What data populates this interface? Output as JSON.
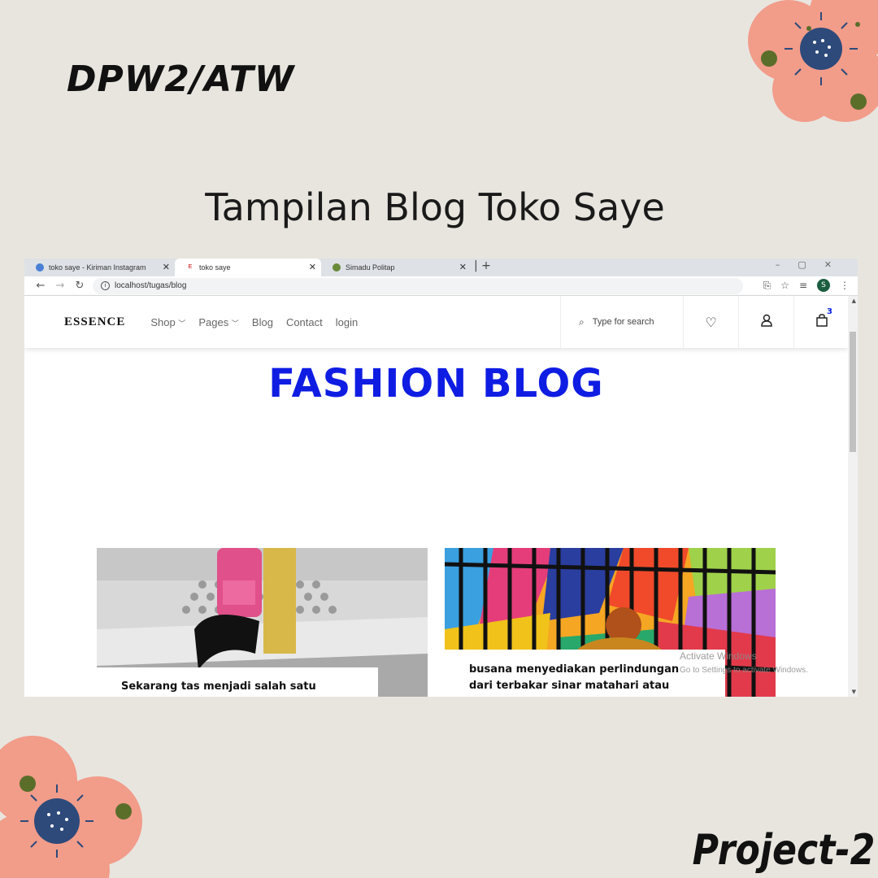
{
  "slide": {
    "top_label": "DPW2/ATW",
    "heading": "Tampilan Blog Toko Saye",
    "footer": "Project-2"
  },
  "browser": {
    "tabs": [
      {
        "label": "toko saye - Kiriman Instagram",
        "icon": "chrome-icon"
      },
      {
        "label": "toko saye",
        "icon": "essence-favicon"
      },
      {
        "label": "Simadu Politap",
        "icon": "politap-icon"
      }
    ],
    "url": "localhost/tugas/blog",
    "profile_initial": "S"
  },
  "site": {
    "logo": "ESSENCE",
    "nav": [
      "Shop",
      "Pages",
      "Blog",
      "Contact",
      "login"
    ],
    "search_placeholder": "Type for search",
    "cart_count": "3"
  },
  "blog": {
    "title": "FASHION BLOG",
    "posts": [
      {
        "caption": "Sekarang tas menjadi salah satu industri"
      },
      {
        "caption": "busana menyediakan perlindungan dari terbakar sinar matahari atau berbagai"
      }
    ]
  },
  "watermark": {
    "title": "Activate Windows",
    "subtitle": "Go to Settings to activate Windows."
  },
  "colors": {
    "background": "#e8e5df",
    "blog_title": "#0f1de3",
    "flower_petal": "#f29c8a",
    "flower_center": "#2d4a7a",
    "flower_accent": "#5a6e2a"
  }
}
